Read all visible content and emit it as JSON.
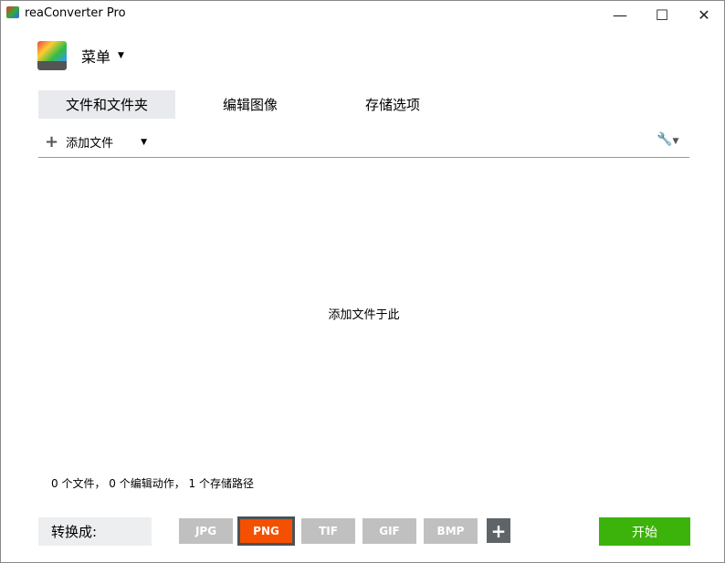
{
  "window": {
    "title": "reaConverter Pro",
    "minimize": "—",
    "maximize": "☐",
    "close": "✕"
  },
  "menu": {
    "label": "菜单"
  },
  "tabs": [
    {
      "label": "文件和文件夹",
      "active": true
    },
    {
      "label": "编辑图像"
    },
    {
      "label": "存储选项"
    }
  ],
  "toolbar": {
    "add_files": "添加文件"
  },
  "main": {
    "drop_hint": "添加文件于此"
  },
  "status": "0 个文件， 0 个编辑动作， 1 个存储路径",
  "convert": {
    "label": "转换成:",
    "formats": [
      "JPG",
      "PNG",
      "TIF",
      "GIF",
      "BMP"
    ],
    "selected": "PNG",
    "add": "+",
    "start": "开始"
  },
  "colors": {
    "accent": "#f55000",
    "start": "#3cb30a"
  }
}
